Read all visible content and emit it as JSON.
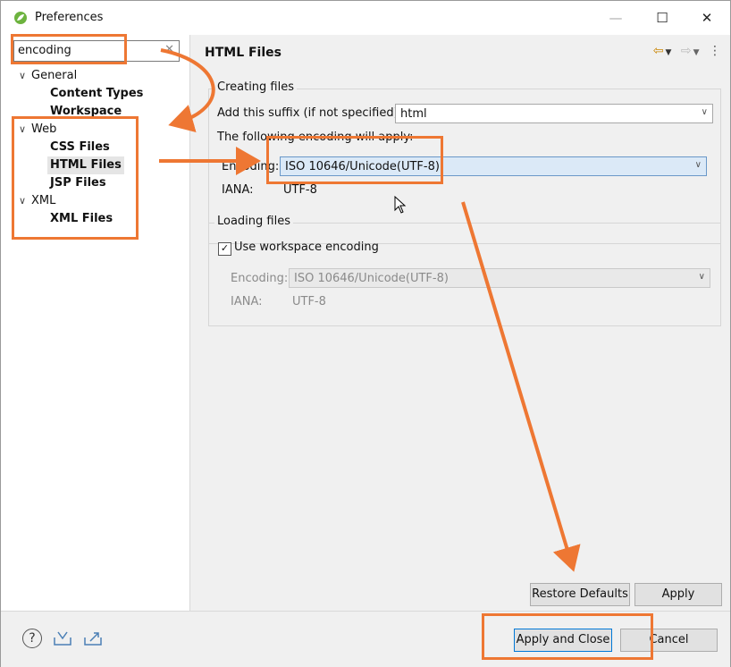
{
  "window": {
    "title": "Preferences",
    "controls": {
      "minimize": "—",
      "maximize": "☐",
      "close": "✕"
    }
  },
  "filter": {
    "value": "encoding"
  },
  "tree": [
    {
      "label": "General",
      "expanded": true,
      "bold": false
    },
    {
      "label": "Content Types",
      "bold": true
    },
    {
      "label": "Workspace",
      "bold": true
    },
    {
      "label": "Web",
      "expanded": true,
      "bold": false
    },
    {
      "label": "CSS Files",
      "bold": true
    },
    {
      "label": "HTML Files",
      "bold": true,
      "selected": true
    },
    {
      "label": "JSP Files",
      "bold": true
    },
    {
      "label": "XML",
      "expanded": true,
      "bold": false
    },
    {
      "label": "XML Files",
      "bold": true
    }
  ],
  "page": {
    "title": "HTML Files",
    "creating": {
      "legend": "Creating files",
      "suffix_label": "Add this suffix (if not specified):",
      "suffix_value": "html",
      "note": "The following encoding will apply:",
      "encoding_label": "Encoding:",
      "encoding_value": "ISO 10646/Unicode(UTF-8)",
      "iana_label": "IANA:",
      "iana_value": "UTF-8"
    },
    "loading": {
      "legend": "Loading files",
      "checkbox_label": "Use workspace encoding",
      "checked": true,
      "encoding_label": "Encoding:",
      "encoding_value": "ISO 10646/Unicode(UTF-8)",
      "iana_label": "IANA:",
      "iana_value": "UTF-8"
    },
    "restore_defaults": "Restore Defaults",
    "apply": "Apply"
  },
  "footer": {
    "apply_and_close": "Apply and Close",
    "cancel": "Cancel"
  },
  "colors": {
    "annotation": "#ee7733",
    "selection": "#e5e5e5",
    "highlight": "#dbe9f7"
  }
}
